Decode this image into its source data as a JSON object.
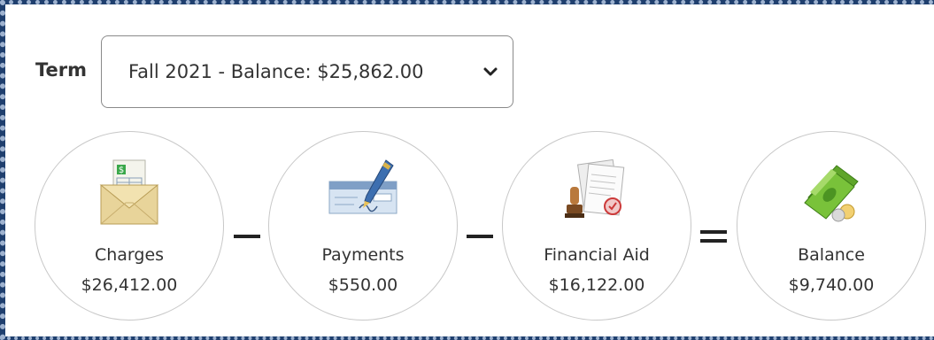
{
  "term": {
    "label": "Term",
    "selected": "Fall 2021 - Balance: $25,862.00",
    "chevron_icon": "chevron-down-icon"
  },
  "summary": [
    {
      "label": "Charges",
      "amount": "$26,412.00",
      "icon": "charges-envelope-icon"
    },
    {
      "label": "Payments",
      "amount": "$550.00",
      "icon": "payment-check-icon"
    },
    {
      "label": "Financial Aid",
      "amount": "$16,122.00",
      "icon": "financial-aid-document-icon"
    },
    {
      "label": "Balance",
      "amount": "$9,740.00",
      "icon": "money-stack-icon"
    }
  ],
  "operators": [
    "minus",
    "minus",
    "equals"
  ],
  "colors": {
    "frame_border": "#1f3f6e",
    "circle_border": "#c8c8c8",
    "text": "#333333"
  }
}
